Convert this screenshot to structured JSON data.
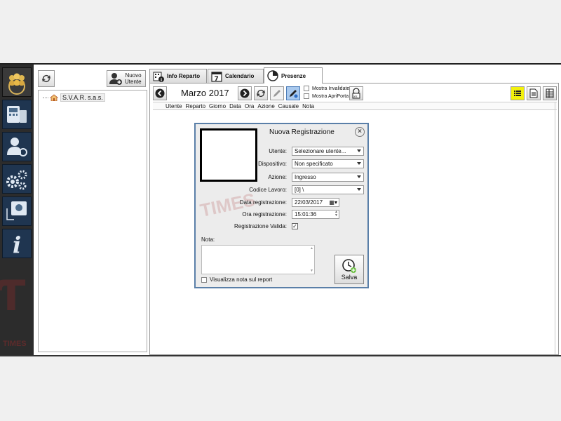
{
  "sidebar": {
    "nav_items": [
      "users-group-icon",
      "terminal-device-icon",
      "user-key-icon",
      "gears-icon",
      "support-headset-icon",
      "info-icon"
    ],
    "watermark": "TIMES"
  },
  "tree_panel": {
    "new_user_label_1": "Nuovo",
    "new_user_label_2": "Utente",
    "root_item": "S.V.A.R. s.a.s."
  },
  "tabs": [
    {
      "label": "Info Reparto"
    },
    {
      "label": "Calendario",
      "icon_text": "7"
    },
    {
      "label": "Presenze"
    }
  ],
  "toolbar": {
    "month": "Marzo 2017",
    "show_invalid": "Mostra Invalidate",
    "show_open_door": "Mostra ApriPorta"
  },
  "columns": [
    "Utente",
    "Reparto",
    "Giorno",
    "Data",
    "Ora",
    "Azione",
    "Causale",
    "Nota"
  ],
  "dialog": {
    "title": "Nuova Registrazione",
    "user_label": "Utente:",
    "user_value": "Selezionare utente...",
    "device_label": "Dispositivo:",
    "device_value": "Non specificato",
    "action_label": "Azione:",
    "action_value": "Ingresso",
    "work_code_label": "Codice Lavoro:",
    "work_code_value": "[0] \\",
    "date_label": "Data registrazione:",
    "date_value": "22/03/2017",
    "time_label": "Ora registrazione:",
    "time_value": "15:01:36",
    "valid_label": "Registrazione Valida:",
    "valid_mark": "✓",
    "note_label": "Nota:",
    "show_note_label": "Visualizza nota sul report",
    "save_label": "Salva",
    "watermark": "TIMES"
  }
}
